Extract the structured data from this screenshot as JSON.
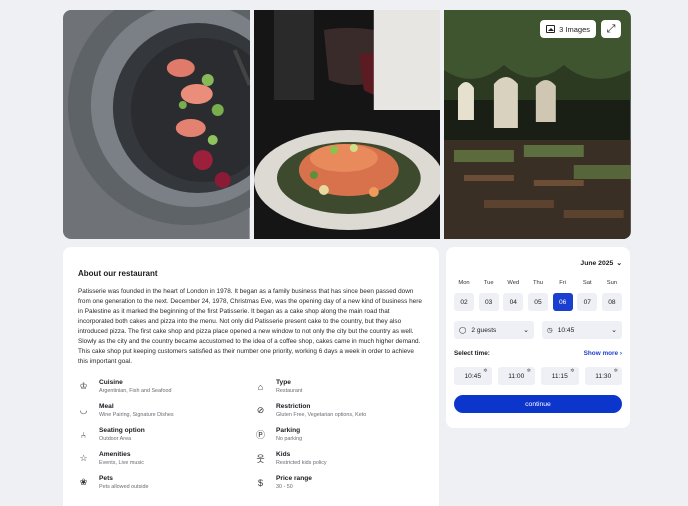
{
  "gallery": {
    "images_badge": "3 Images",
    "photos": [
      "salmon-plate",
      "salmon-dish",
      "restaurant-interior"
    ]
  },
  "about": {
    "heading": "About our restaurant",
    "description": "Patisserie was founded in the heart of London in 1978. It began as a family business that has since been passed down from one generation to the next. December 24, 1978, Christmas Eve, was the opening day of a new kind of business here in Palestine as it marked the beginning of the first Patisserie. It began as a cake shop along the main road that incorporated both cakes and pizza into the menu. Not only did Patisserie present cake to the country, but they also introduced pizza. The first cake shop and pizza place opened a new window to not only the city but the country as well. Slowly as the city and the country became accustomed to the idea of a coffee shop, cakes came in much higher demand. This cake shop put keeping customers satisfied as their number one priority, working 6 days a week in order to achieve this important goal.",
    "features": [
      {
        "icon": "chef-hat-icon",
        "title": "Cuisine",
        "value": "Argentinian, Fish and Seafood"
      },
      {
        "icon": "house-icon",
        "title": "Type",
        "value": "Restaurant"
      },
      {
        "icon": "meal-icon",
        "title": "Meal",
        "value": "Wine Pairing, Signature Dishes"
      },
      {
        "icon": "restriction-icon",
        "title": "Restriction",
        "value": "Gluten Free, Vegetarian options, Keto"
      },
      {
        "icon": "chair-icon",
        "title": "Seating option",
        "value": "Outdoor Area"
      },
      {
        "icon": "parking-icon",
        "title": "Parking",
        "value": "No parking"
      },
      {
        "icon": "star-icon",
        "title": "Amenities",
        "value": "Events, Live music"
      },
      {
        "icon": "kids-icon",
        "title": "Kids",
        "value": "Restricted kids policy"
      },
      {
        "icon": "paw-icon",
        "title": "Pets",
        "value": "Pets allowed outside"
      },
      {
        "icon": "dollar-icon",
        "title": "Price range",
        "value": "30 - 50"
      }
    ]
  },
  "booking": {
    "month": "June 2025",
    "days": [
      {
        "name": "Mon",
        "date": "02",
        "selected": false
      },
      {
        "name": "Tue",
        "date": "03",
        "selected": false
      },
      {
        "name": "Wed",
        "date": "04",
        "selected": false
      },
      {
        "name": "Thu",
        "date": "05",
        "selected": false
      },
      {
        "name": "Fri",
        "date": "06",
        "selected": true
      },
      {
        "name": "Sat",
        "date": "07",
        "selected": false
      },
      {
        "name": "Sun",
        "date": "08",
        "selected": false
      }
    ],
    "guests": "2 guests",
    "time": "10:45",
    "select_time_label": "Select time:",
    "show_more": "Show more",
    "slots": [
      "10:45",
      "11:00",
      "11:15",
      "11:30"
    ],
    "continue_label": "continue",
    "accent": "#1a3fd0"
  }
}
